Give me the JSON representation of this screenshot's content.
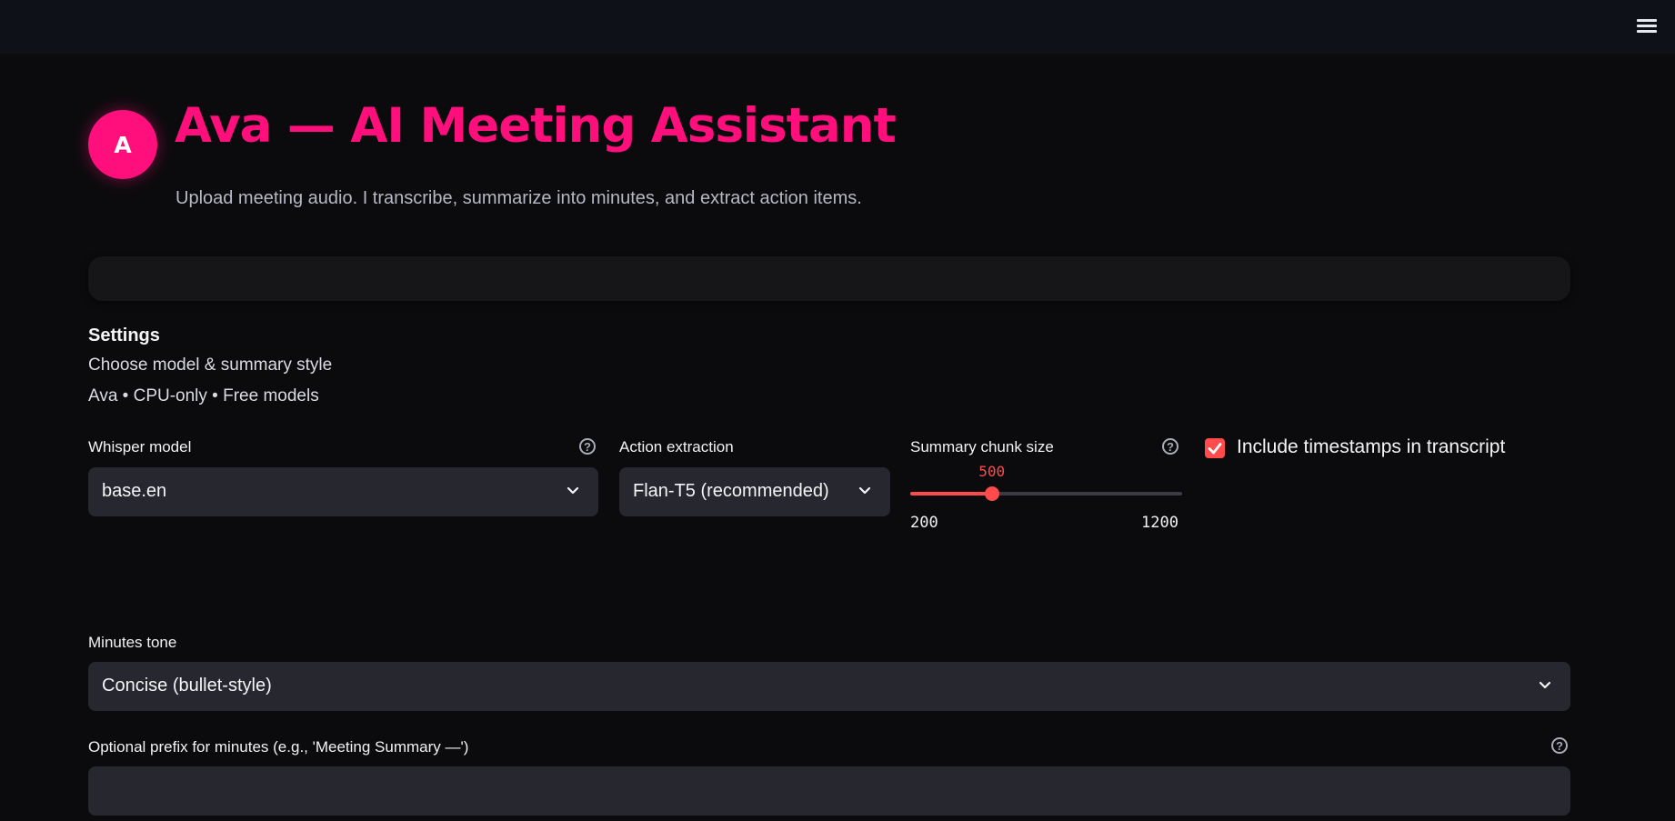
{
  "header": {
    "avatar_letter": "A",
    "title": "Ava — AI Meeting Assistant",
    "subtitle": "Upload meeting audio. I transcribe, summarize into minutes, and extract action items."
  },
  "settings": {
    "title": "Settings",
    "caption_1": "Choose model & summary style",
    "caption_2": "Ava • CPU-only • Free models"
  },
  "whisper_model": {
    "label": "Whisper model",
    "value": "base.en"
  },
  "action_extraction": {
    "label": "Action extraction",
    "value": "Flan-T5 (recommended)"
  },
  "chunk_size": {
    "label": "Summary chunk size",
    "value": 500,
    "min": 200,
    "max": 1200,
    "value_label": "500",
    "min_label": "200",
    "max_label": "1200"
  },
  "timestamps": {
    "label": "Include timestamps in transcript",
    "checked": true
  },
  "minutes_tone": {
    "label": "Minutes tone",
    "value": "Concise (bullet-style)"
  },
  "prefix": {
    "label": "Optional prefix for minutes (e.g., 'Meeting Summary —')",
    "value": ""
  },
  "colors": {
    "accent": "#ff0f7b",
    "slider": "#ff4b4b",
    "background": "#0b0b0d",
    "input_bg": "#26272f"
  },
  "icons": {
    "menu": "hamburger-menu-icon",
    "help": "question-circle-icon",
    "dropdown": "chevron-down-icon",
    "check": "checkmark-icon"
  }
}
